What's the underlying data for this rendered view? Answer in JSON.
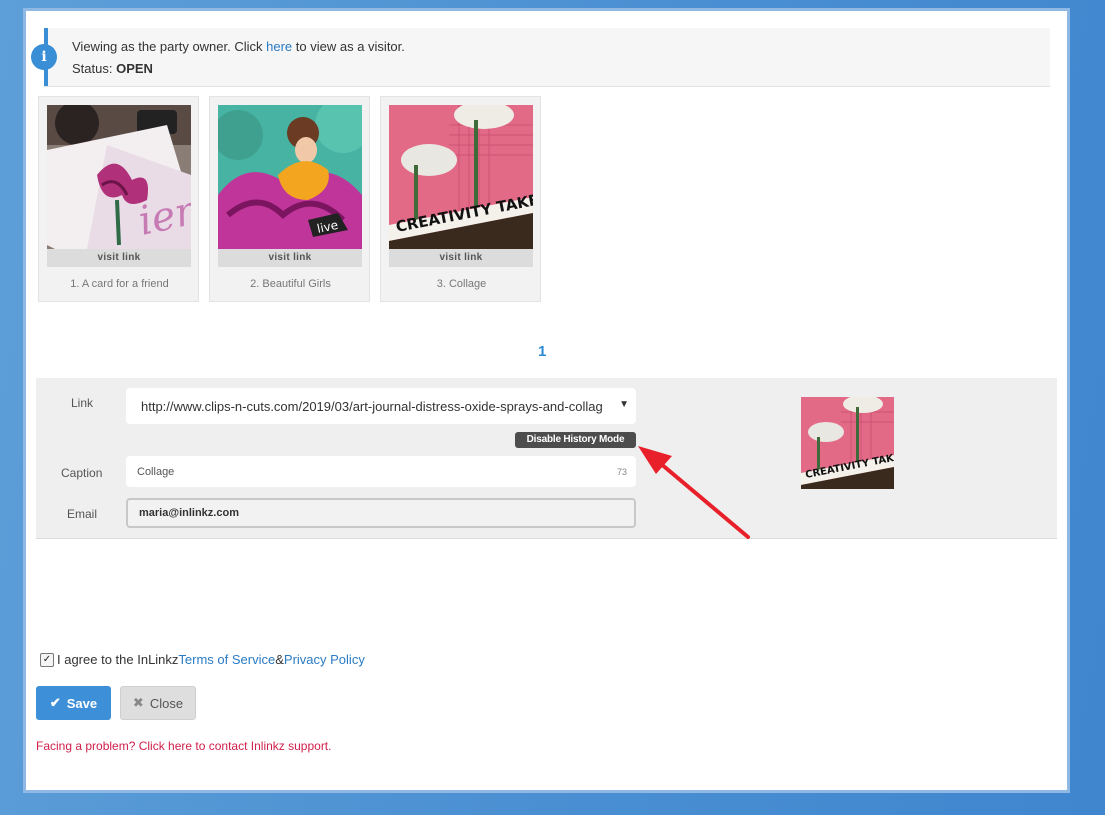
{
  "notice": {
    "icon": "info-icon",
    "line1_prefix": "Viewing as the party owner. Click ",
    "line1_link": "here",
    "line1_suffix": " to view as a visitor.",
    "status_label": "Status: ",
    "status_value": "OPEN"
  },
  "thumbnails": [
    {
      "visit": "visit link",
      "caption": "1. A card for a friend"
    },
    {
      "visit": "visit link",
      "caption": "2. Beautiful Girls"
    },
    {
      "visit": "visit link",
      "caption": "3. Collage"
    }
  ],
  "pagination": {
    "current": "1"
  },
  "form": {
    "link_label": "Link",
    "link_value": "http://www.clips-n-cuts.com/2019/03/art-journal-distress-oxide-sprays-and-collag",
    "history_button": "Disable History Mode",
    "caption_label": "Caption",
    "caption_value": "Collage",
    "caption_count": "73",
    "email_label": "Email",
    "email_value": "maria@inlinkz.com"
  },
  "agreement": {
    "prefix": "I agree to the InLinkz ",
    "tos": "Terms of Service",
    "amp": " & ",
    "privacy": "Privacy Policy",
    "checked": true
  },
  "buttons": {
    "save": "Save",
    "close": "Close"
  },
  "help_text": "Facing a problem? Click here to contact Inlinkz support.",
  "colors": {
    "accent": "#3d8fd7",
    "error": "#d0204a",
    "annotation_arrow": "#e8202a"
  }
}
